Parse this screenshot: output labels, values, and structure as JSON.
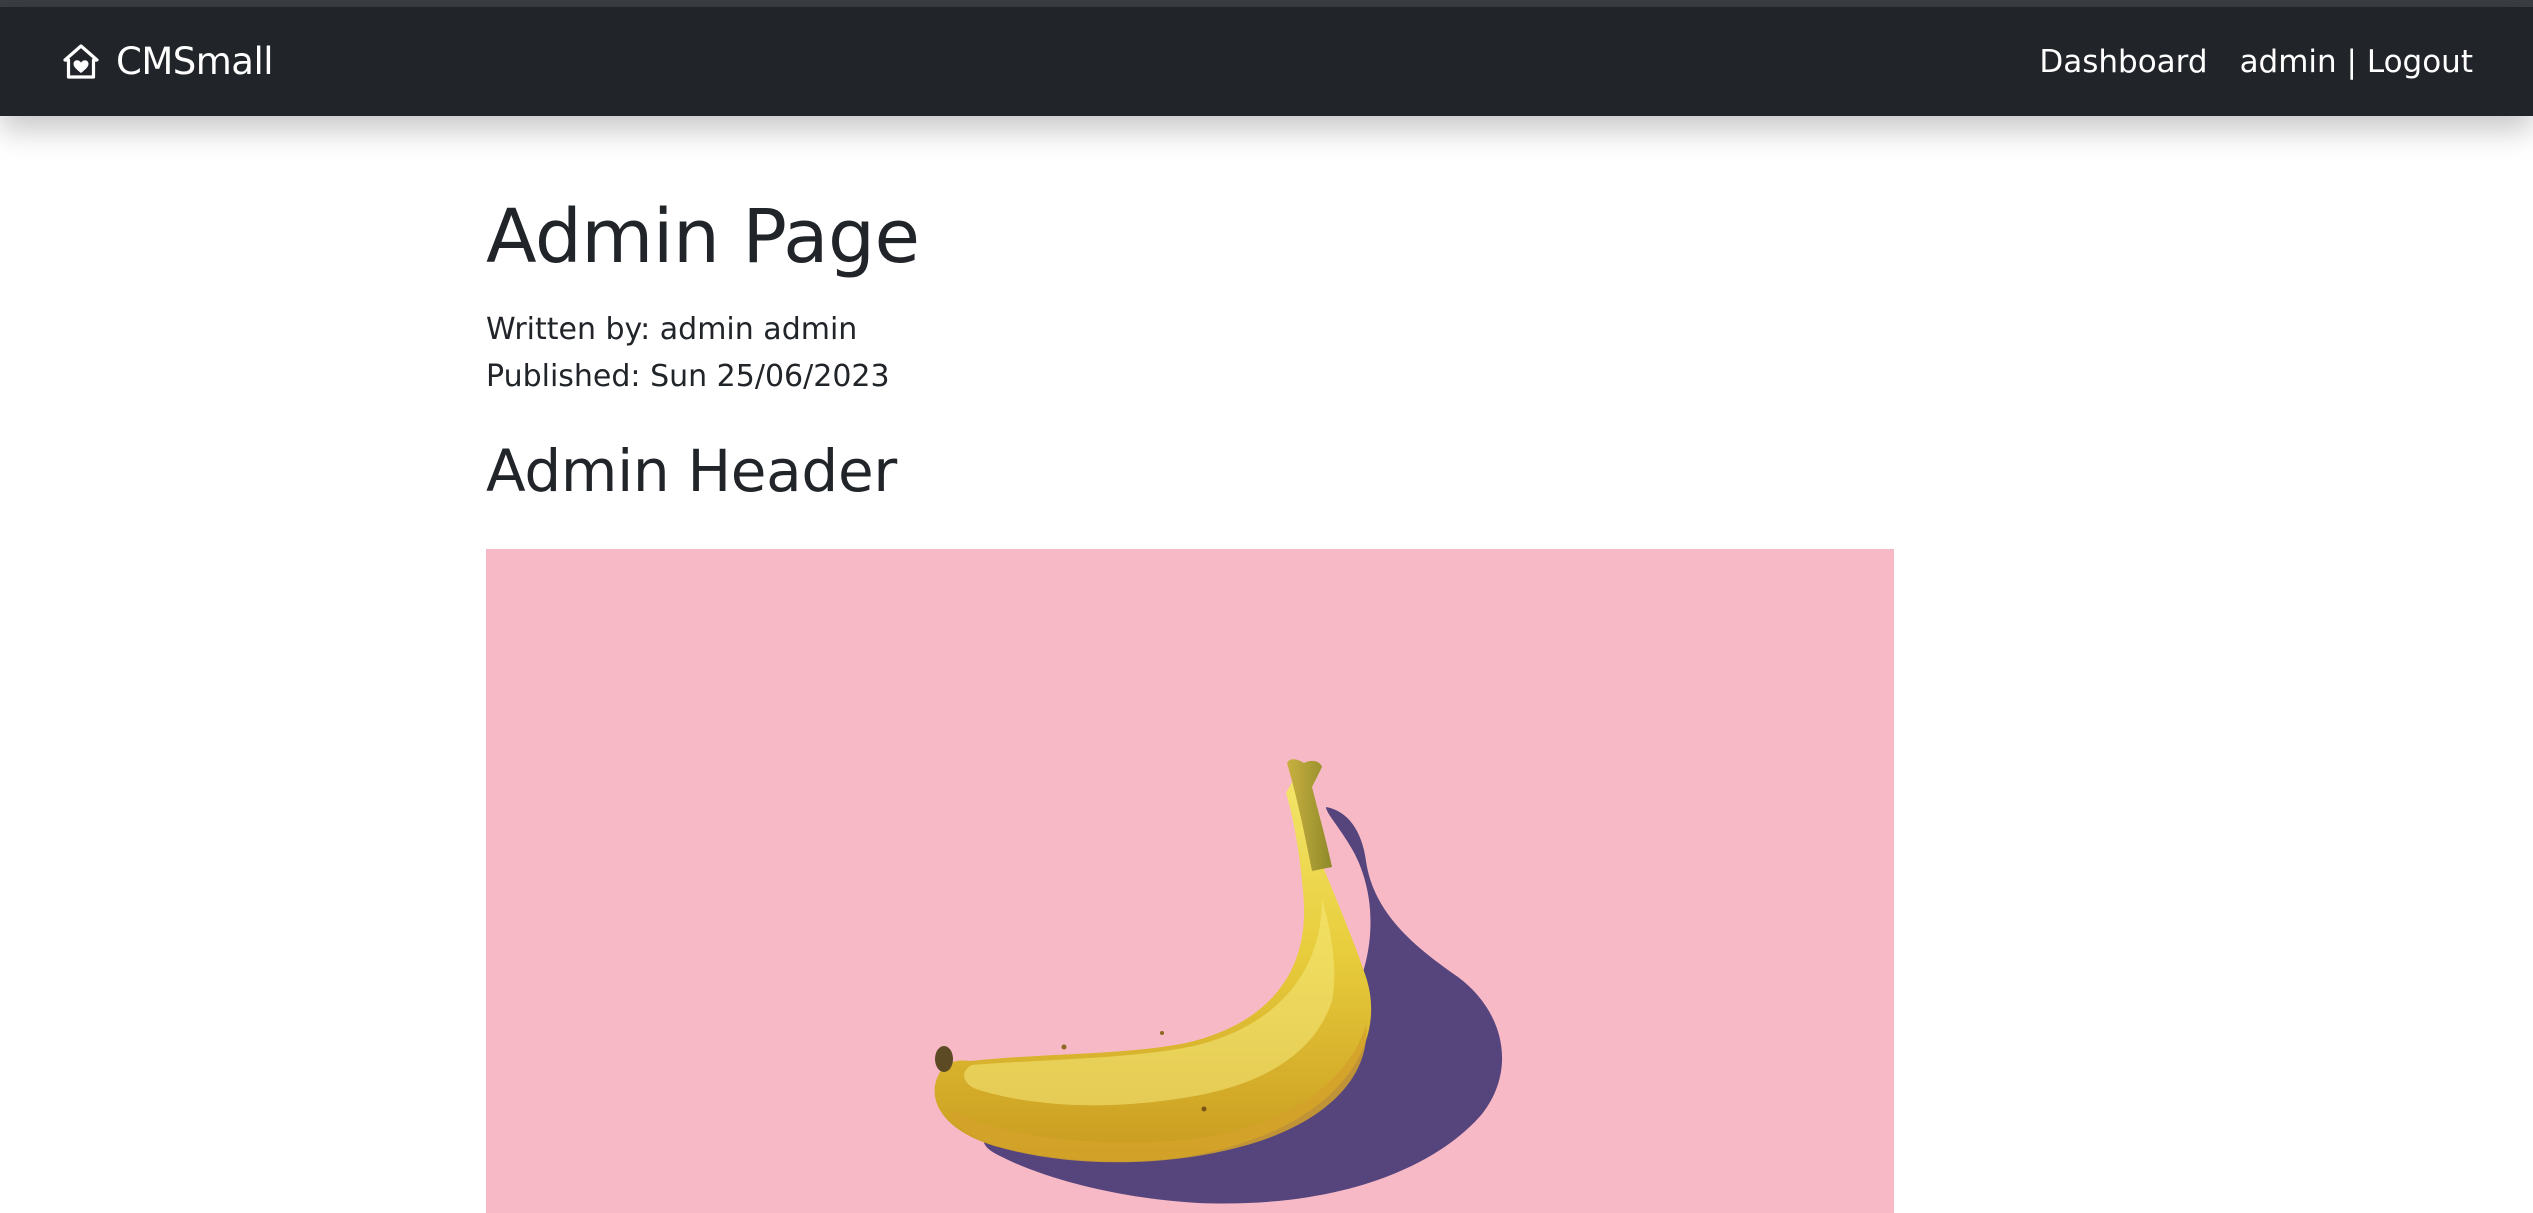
{
  "navbar": {
    "brand": "CMSmall",
    "brand_icon": "home-heart-icon",
    "links": {
      "dashboard": "Dashboard",
      "user_logout": "admin | Logout"
    }
  },
  "page": {
    "title": "Admin Page",
    "author_line": "Written by: admin admin",
    "published_line": "Published: Sun 25/06/2023",
    "header": "Admin Header"
  },
  "colors": {
    "navbar_bg": "#212529",
    "text": "#212529",
    "image_bg": "#f7b9c6",
    "banana_yellow": "#e9cf3f",
    "shadow": "#55457c"
  }
}
